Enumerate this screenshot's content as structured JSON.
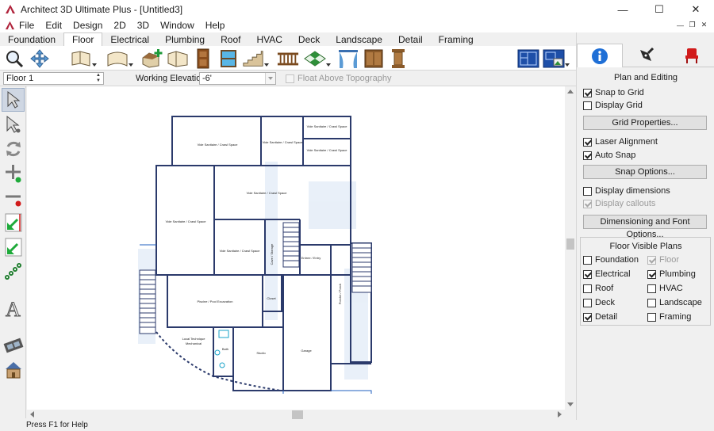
{
  "window": {
    "title": "Architect 3D Ultimate Plus - [Untitled3]",
    "controls": {
      "minimize": "—",
      "maximize": "☐",
      "close": "✕"
    }
  },
  "menu": [
    "File",
    "Edit",
    "Design",
    "2D",
    "3D",
    "Window",
    "Help"
  ],
  "tabs": [
    "Foundation",
    "Floor",
    "Electrical",
    "Plumbing",
    "Roof",
    "HVAC",
    "Deck",
    "Landscape",
    "Detail",
    "Framing"
  ],
  "active_tab": "Floor",
  "toolbar_icons": [
    "zoom-icon",
    "pan-icon",
    "wall-icon",
    "curved-wall-icon",
    "room-add-icon",
    "room-edit-icon",
    "door-icon",
    "window-icon",
    "stairs-icon",
    "railing-icon",
    "flooring-icon",
    "curtain-icon",
    "cabinet-icon",
    "column-icon",
    "plan-view-icon",
    "3d-view-icon"
  ],
  "options_bar": {
    "floor": "Floor 1",
    "working_elevation_label": "Working Elevation:",
    "working_elevation": "-6'",
    "float_label": "Float Above Topography",
    "float_checked": false
  },
  "left_tools": [
    "select-arrow-icon",
    "edit-arrow-icon",
    "rotate-icon",
    "add-point-icon",
    "delete-point-icon",
    "snap-icon",
    "trim-icon",
    "chain-icon",
    "text-icon",
    "film-icon",
    "house-icon"
  ],
  "right_panel": {
    "tabs": [
      "info-icon",
      "pen-icon",
      "chair-icon"
    ],
    "section_title": "Plan and Editing",
    "options": [
      {
        "label": "Snap to Grid",
        "checked": true,
        "enabled": true
      },
      {
        "label": "Display Grid",
        "checked": false,
        "enabled": true
      }
    ],
    "grid_button": "Grid Properties...",
    "snap_options": [
      {
        "label": "Laser Alignment",
        "checked": true,
        "enabled": true
      },
      {
        "label": "Auto Snap",
        "checked": true,
        "enabled": true
      }
    ],
    "snap_button": "Snap Options...",
    "display_options": [
      {
        "label": "Display dimensions",
        "checked": false,
        "enabled": true
      },
      {
        "label": "Display callouts",
        "checked": true,
        "enabled": false
      }
    ],
    "dim_button": "Dimensioning and Font Options...",
    "visible_title": "Floor Visible Plans",
    "visible_plans": [
      {
        "label": "Foundation",
        "checked": false,
        "enabled": true
      },
      {
        "label": "Floor",
        "checked": true,
        "enabled": false
      },
      {
        "label": "Electrical",
        "checked": true,
        "enabled": true
      },
      {
        "label": "Plumbing",
        "checked": true,
        "enabled": true
      },
      {
        "label": "Roof",
        "checked": false,
        "enabled": true
      },
      {
        "label": "HVAC",
        "checked": false,
        "enabled": true
      },
      {
        "label": "Deck",
        "checked": false,
        "enabled": true
      },
      {
        "label": "Landscape",
        "checked": false,
        "enabled": true
      },
      {
        "label": "Detail",
        "checked": true,
        "enabled": true
      },
      {
        "label": "Framing",
        "checked": false,
        "enabled": true
      }
    ]
  },
  "floorplan": {
    "rooms": [
      "Vide Sanitaire / Crawl Space",
      "Vide Sanitaire / Crawl Space",
      "Vide Sanitaire / Crawl Space",
      "Vide Sanitaire / Crawl Space",
      "Vide Sanitaire / Crawl Space",
      "Vide Sanitaire / Crawl Space",
      "Vide Sanitaire / Crawl Space",
      "Entree / Entry",
      "Cave / Storage",
      "Porche / Porch",
      "Piscine / Pool Excavation",
      "Closet",
      "Local Technique",
      "Mechanical",
      "Bath",
      "Studio",
      "Garage"
    ]
  },
  "status": "Press F1 for Help",
  "colors": {
    "wall": "#2b3a6b",
    "accent": "#1f5fbf",
    "selected_tool": "#cfd7e3"
  }
}
